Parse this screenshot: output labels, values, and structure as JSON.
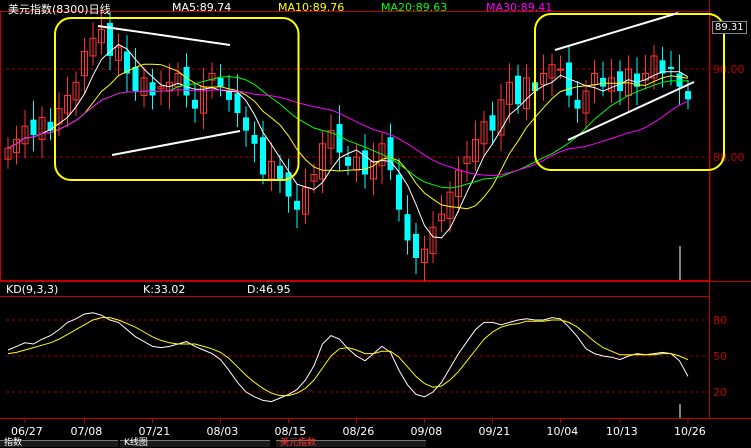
{
  "chart_data": [
    {
      "type": "candlestick",
      "title": "美元指数(8300)日线",
      "ylim": [
        85.2,
        91.3
      ],
      "yticks": [
        {
          "label": "90.00",
          "value": 90.0
        },
        {
          "label": "88.00",
          "value": 88.0
        }
      ],
      "last_label": "89.31",
      "x_ticks": [
        {
          "label": "06/27",
          "index": 2
        },
        {
          "label": "07/08",
          "index": 9
        },
        {
          "label": "07/21",
          "index": 17
        },
        {
          "label": "08/03",
          "index": 25
        },
        {
          "label": "08/15",
          "index": 33
        },
        {
          "label": "08/26",
          "index": 41
        },
        {
          "label": "09/08",
          "index": 49
        },
        {
          "label": "09/21",
          "index": 57
        },
        {
          "label": "10/04",
          "index": 65
        },
        {
          "label": "10/13",
          "index": 72
        },
        {
          "label": "10/26",
          "index": 80
        }
      ],
      "ma_labels": [
        {
          "name": "MA5",
          "text": "MA5:89.74",
          "color": "#ffffff"
        },
        {
          "name": "MA10",
          "text": "MA10:89.76",
          "color": "#ffff00"
        },
        {
          "name": "MA20",
          "text": "MA20:89.63",
          "color": "#00ff00"
        },
        {
          "name": "MA30",
          "text": "MA30:89.41",
          "color": "#ff00ff"
        }
      ],
      "closes": [
        88.2,
        88.4,
        88.7,
        88.5,
        88.9,
        88.6,
        89.1,
        89.4,
        89.7,
        90.4,
        90.7,
        90.9,
        90.3,
        90.5,
        89.9,
        89.5,
        89.8,
        89.4,
        89.6,
        89.7,
        89.9,
        89.4,
        89.1,
        89.6,
        89.9,
        89.6,
        89.3,
        89.0,
        88.6,
        88.3,
        87.6,
        87.9,
        87.5,
        87.1,
        86.8,
        87.3,
        87.6,
        88.3,
        88.6,
        88.1,
        87.8,
        88.0,
        87.6,
        87.9,
        88.3,
        87.7,
        86.8,
        86.1,
        85.7,
        85.9,
        86.4,
        86.7,
        87.2,
        87.7,
        88.0,
        88.4,
        88.8,
        88.6,
        89.3,
        89.7,
        89.2,
        89.8,
        89.5,
        89.9,
        90.1,
        90.0,
        89.4,
        89.1,
        89.5,
        89.9,
        89.6,
        89.8,
        89.5,
        90.0,
        89.6,
        89.9,
        90.3,
        89.9,
        90.0,
        89.6,
        89.31
      ],
      "annotations": [
        {
          "type": "highlight-rounded-rect",
          "from_index": 6,
          "to_index": 33,
          "color": "#ffff00"
        },
        {
          "type": "highlight-rounded-rect",
          "from_index": 66,
          "to_index": 90,
          "color": "#ffff00"
        }
      ],
      "trendlines_note": "white converging wedge lines inside left box; rising wedge lines inside right box"
    },
    {
      "type": "line",
      "title": "KD(9,3,3)",
      "header_values": [
        {
          "name": "K",
          "text": "K:33.02",
          "color": "#ffffff"
        },
        {
          "name": "D",
          "text": "D:46.95",
          "color": "#ffffff"
        }
      ],
      "ylim": [
        0,
        100
      ],
      "yticks": [
        {
          "label": "80",
          "value": 80
        },
        {
          "label": "50",
          "value": 50
        },
        {
          "label": "20",
          "value": 20
        }
      ],
      "series": [
        {
          "name": "K",
          "color": "#ffffff",
          "values": [
            55,
            58,
            61,
            60,
            64,
            67,
            72,
            78,
            81,
            85,
            86,
            84,
            80,
            78,
            72,
            66,
            62,
            58,
            57,
            58,
            60,
            62,
            58,
            55,
            52,
            47,
            38,
            28,
            20,
            16,
            13,
            12,
            15,
            18,
            22,
            30,
            42,
            60,
            67,
            64,
            56,
            50,
            46,
            52,
            58,
            53,
            38,
            26,
            18,
            16,
            20,
            28,
            40,
            52,
            62,
            72,
            78,
            78,
            76,
            78,
            80,
            81,
            80,
            80,
            82,
            81,
            74,
            66,
            56,
            52,
            50,
            49,
            47,
            50,
            52,
            51,
            52,
            53,
            52,
            46,
            33.02
          ]
        },
        {
          "name": "D",
          "color": "#ffff00",
          "values": [
            52,
            53,
            55,
            57,
            59,
            61,
            64,
            68,
            72,
            76,
            80,
            82,
            82,
            80,
            77,
            74,
            70,
            66,
            63,
            61,
            60,
            60,
            60,
            58,
            56,
            53,
            48,
            41,
            34,
            28,
            23,
            19,
            17,
            17,
            19,
            23,
            30,
            40,
            50,
            56,
            57,
            55,
            52,
            52,
            54,
            54,
            49,
            41,
            33,
            27,
            24,
            25,
            30,
            37,
            46,
            55,
            64,
            70,
            74,
            76,
            77,
            79,
            79,
            79,
            80,
            80,
            78,
            74,
            68,
            62,
            57,
            54,
            51,
            51,
            51,
            51,
            51,
            52,
            52,
            50,
            46.95
          ]
        }
      ]
    }
  ],
  "status_tabs": [
    {
      "text": "指数"
    },
    {
      "text": "K线图"
    },
    {
      "text": "美元指数"
    }
  ]
}
